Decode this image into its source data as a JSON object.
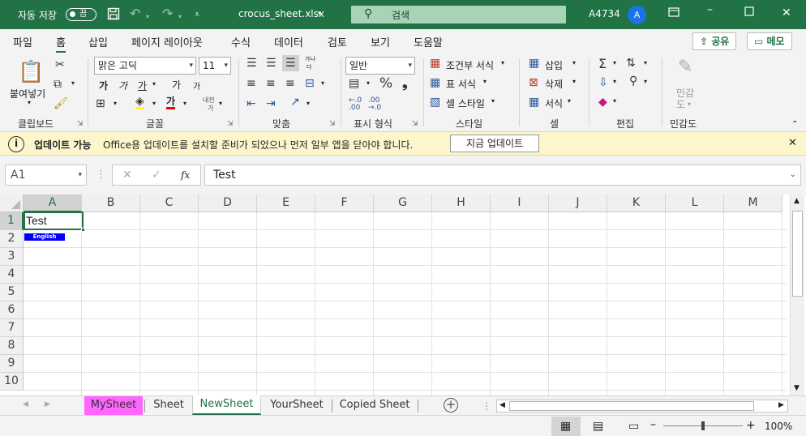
{
  "titlebar": {
    "autosave_label": "자동 저장",
    "autosave_state": "끔",
    "filename": "crocus_sheet.xlsx",
    "search_placeholder": "검색",
    "account": "A4734",
    "avatar_letter": "A",
    "bg_color": "#217346"
  },
  "ribbon": {
    "tabs": [
      "파일",
      "홈",
      "삽입",
      "페이지 레이아웃",
      "수식",
      "데이터",
      "검토",
      "보기",
      "도움말"
    ],
    "active_tab": "홈",
    "share_label": "공유",
    "memo_label": "메모",
    "clipboard": {
      "paste_label": "붙여넣기",
      "group_label": "클립보드"
    },
    "font": {
      "font_name": "맑은 고딕",
      "font_size": "11",
      "bold": "가",
      "italic": "가",
      "underline": "가",
      "grow": "가",
      "shrink": "가",
      "fontcolor": "가",
      "phonetic_top": "내천",
      "phonetic_bottom": "가",
      "group_label": "글꼴"
    },
    "alignment": {
      "wrap_top": "가나",
      "wrap_bottom": "다",
      "group_label": "맞춤"
    },
    "number": {
      "format": "일반",
      "group_label": "표시 형식"
    },
    "styles": {
      "conditional": "조건부 서식",
      "table": "표 서식",
      "cell_style": "셀 스타일",
      "group_label": "스타일"
    },
    "cells": {
      "insert": "삽입",
      "delete": "삭제",
      "format": "서식",
      "group_label": "셀"
    },
    "editing": {
      "group_label": "편집"
    },
    "sensitivity": {
      "label_top": "민감",
      "label_bottom": "도",
      "group_label": "민감도"
    }
  },
  "infobar": {
    "title": "업데이트 가능",
    "message": "Office용 업데이트를 설치할 준비가 되었으나 먼저 일부 앱을 닫아야 합니다.",
    "button": "지금 업데이트"
  },
  "formula_bar": {
    "name_box": "A1",
    "fx": "fx",
    "content": "Test"
  },
  "grid": {
    "columns": [
      "A",
      "B",
      "C",
      "D",
      "E",
      "F",
      "G",
      "H",
      "I",
      "J",
      "K",
      "L",
      "M"
    ],
    "rows": [
      "1",
      "2",
      "3",
      "4",
      "5",
      "6",
      "7",
      "8",
      "9",
      "10"
    ],
    "cell_a1": "Test",
    "cell_a2": "English",
    "cell_a2_bg": "#0000ff"
  },
  "sheets": {
    "tabs": [
      "MySheet",
      "Sheet",
      "NewSheet",
      "YourSheet",
      "Copied Sheet"
    ],
    "active": "NewSheet",
    "mysheet_color": "#ff66ff"
  },
  "status": {
    "zoom": "100%"
  }
}
